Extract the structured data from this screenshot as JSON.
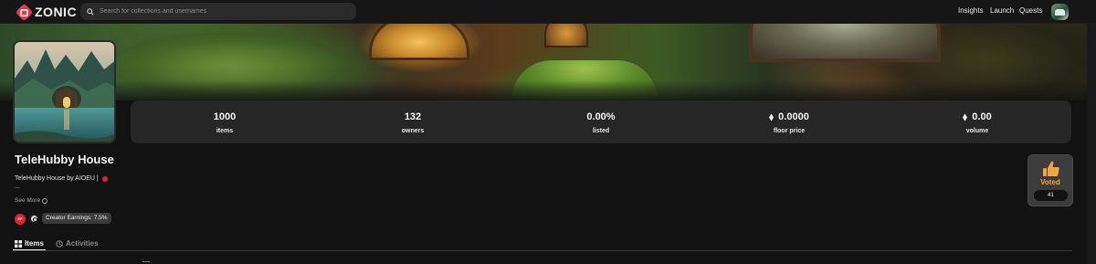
{
  "app": {
    "logo_text": "ZONIC"
  },
  "search": {
    "placeholder": "Search for collections and usernames"
  },
  "nav": {
    "items": [
      "Insights",
      "Launch",
      "Quests"
    ]
  },
  "collection": {
    "name": "TeleHubby House",
    "description": "TeleHubby House by AIOEU |",
    "ellipsis": "...",
    "see_more": "See More",
    "creator_badge": "EF",
    "creator_earnings": "Creator Earnings: 7.5%"
  },
  "stats": [
    {
      "value": "1000",
      "label": "items",
      "eth": false
    },
    {
      "value": "132",
      "label": "owners",
      "eth": false
    },
    {
      "value": "0.00%",
      "label": "listed",
      "eth": false
    },
    {
      "value": "0.0000",
      "label": "floor price",
      "eth": true
    },
    {
      "value": "0.00",
      "label": "volume",
      "eth": true
    }
  ],
  "vote": {
    "label": "Voted",
    "count": "41"
  },
  "tabs": [
    {
      "label": "Items",
      "icon": "grid-icon",
      "active": true
    },
    {
      "label": "Activities",
      "icon": "history-icon",
      "active": false
    }
  ],
  "colors": {
    "accent": "#e23b45",
    "vote": "#f3a63a",
    "background": "#121212",
    "card": "#262626"
  }
}
